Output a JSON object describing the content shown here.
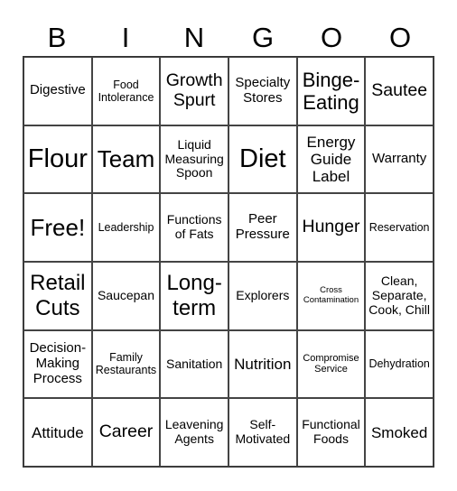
{
  "header": [
    "B",
    "I",
    "N",
    "G",
    "O",
    "O"
  ],
  "rows": [
    [
      "Digestive",
      "Food Intolerance",
      "Growth Spurt",
      "Specialty Stores",
      "Binge-Eating",
      "Sautee"
    ],
    [
      "Flour",
      "Team",
      "Liquid Measuring Spoon",
      "Diet",
      "Energy Guide Label",
      "Warranty"
    ],
    [
      "Free!",
      "Leadership",
      "Functions of Fats",
      "Peer Pressure",
      "Hunger",
      "Reservation"
    ],
    [
      "Retail Cuts",
      "Saucepan",
      "Long-term",
      "Explorers",
      "Cross Contamination",
      "Clean, Separate, Cook, Chill"
    ],
    [
      "Decision-Making Process",
      "Family Restaurants",
      "Sanitation",
      "Nutrition",
      "Compromise Service",
      "Dehydration"
    ],
    [
      "Attitude",
      "Career",
      "Leavening Agents",
      "Self-Motivated",
      "Functional Foods",
      "Smoked"
    ]
  ]
}
